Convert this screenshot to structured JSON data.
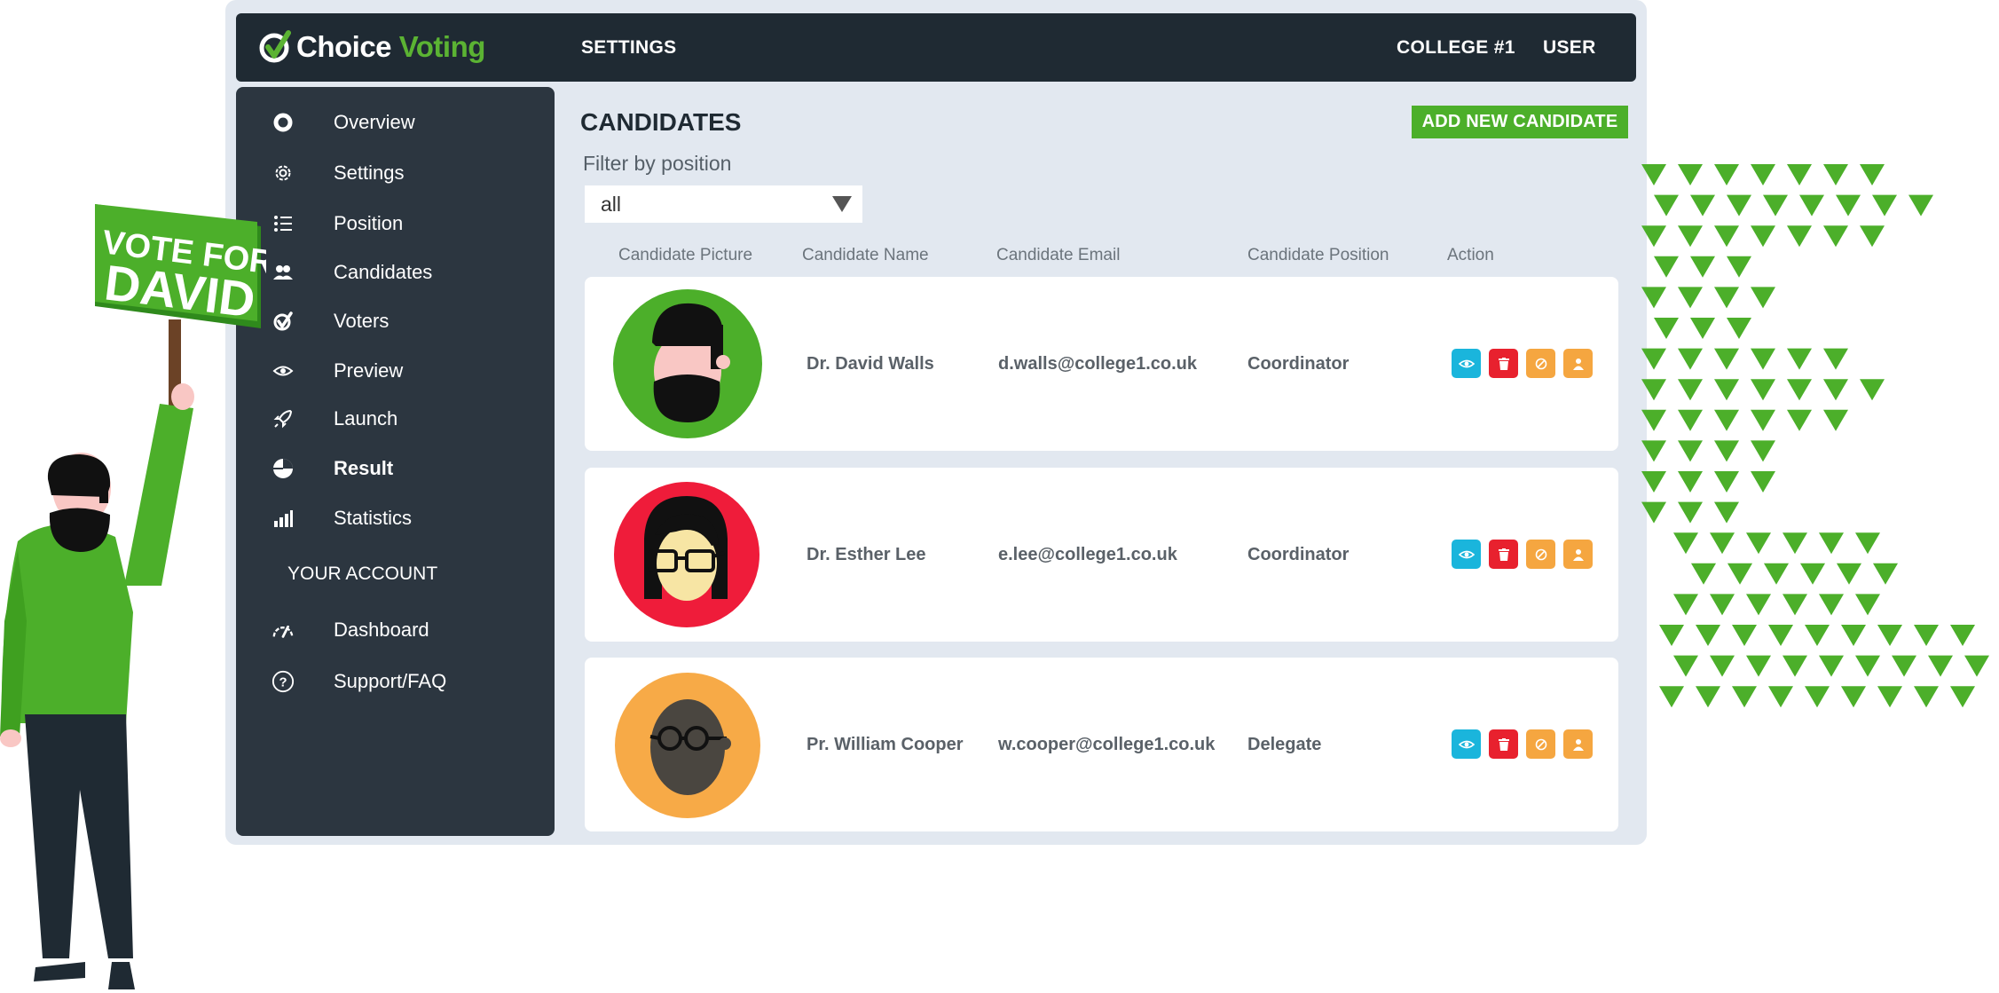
{
  "header": {
    "logo_word1": "Choice",
    "logo_word2": "Voting",
    "settings_label": "SETTINGS",
    "college_label": "COLLEGE #1",
    "user_label": "USER"
  },
  "sidebar": {
    "items": [
      {
        "label": "Overview",
        "icon": "overview-icon"
      },
      {
        "label": "Settings",
        "icon": "gear-icon"
      },
      {
        "label": "Position",
        "icon": "list-icon"
      },
      {
        "label": "Candidates",
        "icon": "users-icon"
      },
      {
        "label": "Voters",
        "icon": "check-badge-icon"
      },
      {
        "label": "Preview",
        "icon": "eye-icon"
      },
      {
        "label": "Launch",
        "icon": "rocket-icon"
      },
      {
        "label": "Result",
        "icon": "pie-chart-icon",
        "active": true
      },
      {
        "label": "Statistics",
        "icon": "bar-chart-icon"
      }
    ],
    "account_heading": "YOUR ACCOUNT",
    "account_items": [
      {
        "label": "Dashboard",
        "icon": "speedometer-icon"
      },
      {
        "label": "Support/FAQ",
        "icon": "question-icon"
      }
    ]
  },
  "main": {
    "title": "CANDIDATES",
    "add_button": "ADD NEW CANDIDATE",
    "filter_label": "Filter by position",
    "filter_value": "all",
    "columns": [
      "Candidate Picture",
      "Candidate Name",
      "Candidate Email",
      "Candidate Position",
      "Action"
    ],
    "candidates": [
      {
        "name": "Dr. David Walls",
        "email": "d.walls@college1.co.uk",
        "position": "Coordinator",
        "avatar_color": "#4caf2a"
      },
      {
        "name": "Dr. Esther Lee",
        "email": "e.lee@college1.co.uk",
        "position": "Coordinator",
        "avatar_color": "#ef1c3a"
      },
      {
        "name": "Pr. William Cooper",
        "email": "w.cooper@college1.co.uk",
        "position": "Delegate",
        "avatar_color": "#f7aa47"
      }
    ],
    "action_colors": {
      "view": "#1ab5dc",
      "delete": "#e8212e",
      "block": "#f5a640",
      "user": "#f5a640"
    }
  },
  "decor": {
    "sign_line1": "VOTE FOR",
    "sign_line2": "DAVID"
  },
  "colors": {
    "brand_green": "#4caf2a",
    "dark": "#1f2a33",
    "sidebar": "#2c3640"
  }
}
